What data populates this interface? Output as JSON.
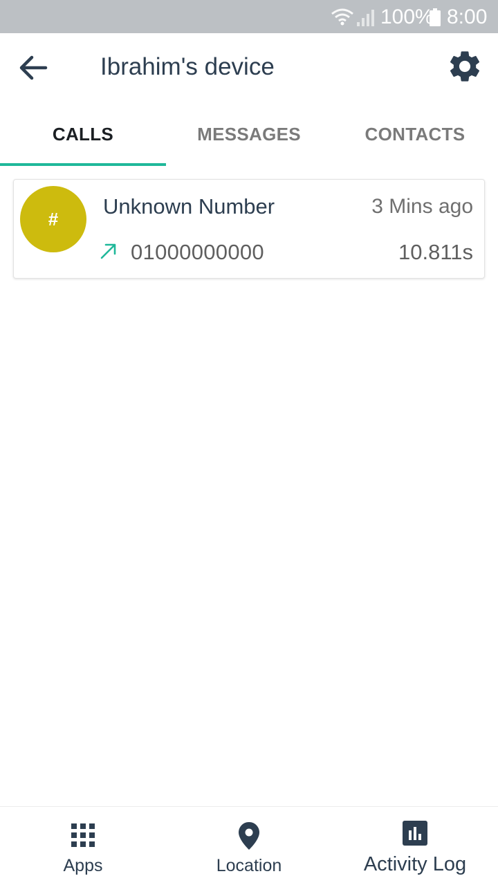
{
  "status_bar": {
    "battery_percent": "100%",
    "time": "8:00",
    "icons": [
      "wifi-icon",
      "signal-icon",
      "battery-icon"
    ]
  },
  "app_bar": {
    "title": "Ibrahim's device",
    "back_icon": "arrow-left-icon",
    "settings_icon": "gear-icon"
  },
  "tabs": [
    {
      "label": "CALLS",
      "active": true
    },
    {
      "label": "MESSAGES",
      "active": false
    },
    {
      "label": "CONTACTS",
      "active": false
    }
  ],
  "calls": [
    {
      "avatar_text": "#",
      "name": "Unknown Number",
      "time_ago": "3 Mins ago",
      "direction": "outgoing",
      "direction_icon": "arrow-up-right-icon",
      "number": "01000000000",
      "duration": "10.811s"
    }
  ],
  "bottom_nav": [
    {
      "label": "Apps",
      "icon": "grid-icon"
    },
    {
      "label": "Location",
      "icon": "map-pin-icon"
    },
    {
      "label": "Activity Log",
      "icon": "bar-chart-icon"
    }
  ],
  "colors": {
    "status_bar": "#bcc0c4",
    "primary_text": "#2d3e50",
    "accent": "#1fb89a",
    "avatar": "#cdbb0e"
  }
}
